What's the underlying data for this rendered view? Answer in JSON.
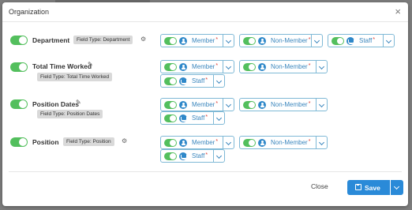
{
  "modal": {
    "title": "Organization",
    "close_glyph": "×"
  },
  "fields": [
    {
      "name": "Department",
      "badge": "Field Type: Department",
      "chips": [
        {
          "role": "member",
          "label": "Member",
          "required": "*"
        },
        {
          "role": "member",
          "label": "Non-Member",
          "required": "*"
        },
        {
          "role": "staff",
          "label": "Staff",
          "required": "*"
        }
      ]
    },
    {
      "name": "Total Time Worked",
      "badge": "Field Type: Total Time Worked",
      "chips": [
        {
          "role": "member",
          "label": "Member",
          "required": "*"
        },
        {
          "role": "member",
          "label": "Non-Member",
          "required": "*"
        },
        {
          "role": "staff",
          "label": "Staff",
          "required": "*"
        }
      ]
    },
    {
      "name": "Position Dates",
      "badge": "Field Type: Position Dates",
      "chips": [
        {
          "role": "member",
          "label": "Member",
          "required": "*"
        },
        {
          "role": "member",
          "label": "Non-Member",
          "required": "*"
        },
        {
          "role": "staff",
          "label": "Staff",
          "required": "*"
        }
      ]
    },
    {
      "name": "Position",
      "badge": "Field Type: Position",
      "chips": [
        {
          "role": "member",
          "label": "Member",
          "required": "*"
        },
        {
          "role": "member",
          "label": "Non-Member",
          "required": "*"
        },
        {
          "role": "staff",
          "label": "Staff",
          "required": "*"
        }
      ]
    }
  ],
  "footer": {
    "close_label": "Close",
    "save_label": "Save"
  },
  "colors": {
    "toggle_on": "#53bf5d",
    "accent": "#2a8ad8",
    "required": "#d9342b"
  }
}
